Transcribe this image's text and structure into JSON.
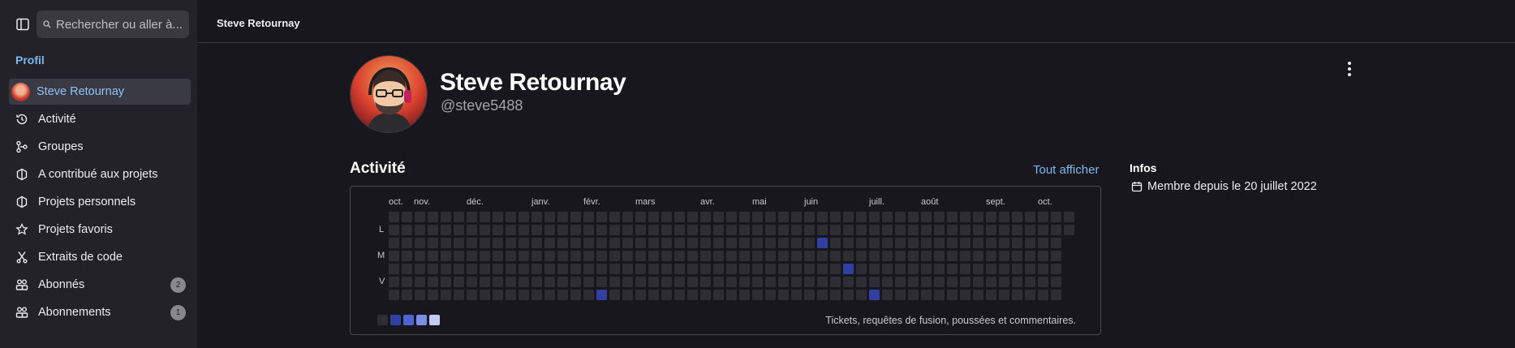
{
  "sidebar": {
    "search_placeholder": "Rechercher ou aller à...",
    "section_title": "Profil",
    "items": [
      {
        "label": "Steve Retournay",
        "icon": "avatar",
        "active": true
      },
      {
        "label": "Activité",
        "icon": "history-icon"
      },
      {
        "label": "Groupes",
        "icon": "group-icon"
      },
      {
        "label": "A contribué aux projets",
        "icon": "project-icon"
      },
      {
        "label": "Projets personnels",
        "icon": "project-icon"
      },
      {
        "label": "Projets favoris",
        "icon": "star-icon"
      },
      {
        "label": "Extraits de code",
        "icon": "snippet-icon"
      },
      {
        "label": "Abonnés",
        "icon": "users-icon",
        "badge": "2"
      },
      {
        "label": "Abonnements",
        "icon": "users-icon",
        "badge": "1"
      }
    ]
  },
  "topbar": {
    "breadcrumb": "Steve Retournay"
  },
  "profile": {
    "name": "Steve Retournay",
    "username": "@steve5488"
  },
  "activity": {
    "title": "Activité",
    "see_all": "Tout afficher",
    "months": [
      "oct.",
      "nov.",
      "déc.",
      "janv.",
      "févr.",
      "mars",
      "avr.",
      "mai",
      "juin",
      "juill.",
      "août",
      "sept.",
      "oct."
    ],
    "day_labels": [
      "L",
      "M",
      "V"
    ],
    "active_cells": [
      {
        "week": 33,
        "day": 2
      },
      {
        "week": 35,
        "day": 4
      },
      {
        "week": 16,
        "day": 6
      },
      {
        "week": 37,
        "day": 6
      }
    ],
    "legend_colors": [
      "#2d2d33",
      "#303fa0",
      "#4f63d2",
      "#7c8fe6",
      "#c3cbf3"
    ],
    "description": "Tickets, requêtes de fusion, poussées et commentaires."
  },
  "infos": {
    "title": "Infos",
    "member_since": "Membre depuis le 20 juillet 2022"
  },
  "colors": {
    "accent": "#7cb8f0",
    "cell_empty": "#2d2d33",
    "cell_active": "#303fa0"
  }
}
